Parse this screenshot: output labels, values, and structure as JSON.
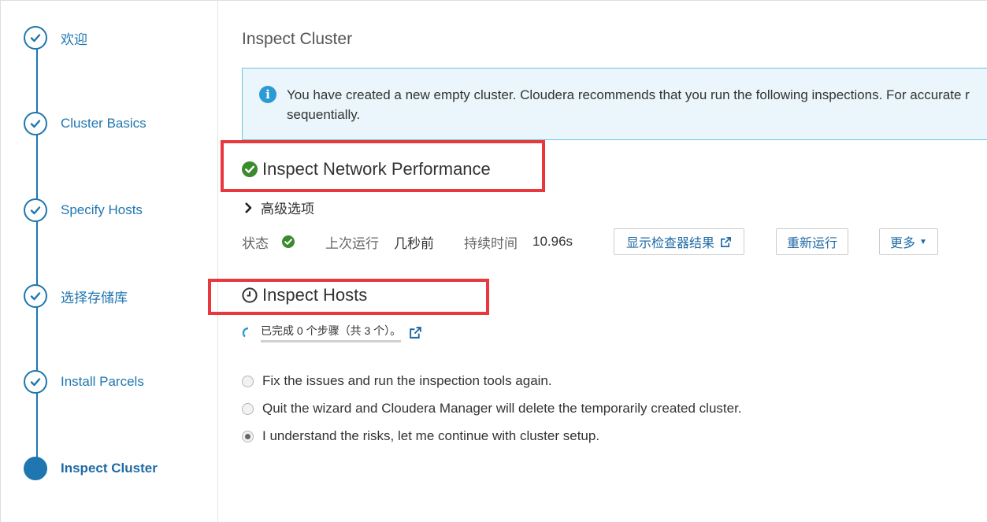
{
  "wizard": {
    "steps": [
      {
        "label": "欢迎",
        "state": "done"
      },
      {
        "label": "Cluster Basics",
        "state": "done"
      },
      {
        "label": "Specify Hosts",
        "state": "done"
      },
      {
        "label": "选择存储库",
        "state": "done"
      },
      {
        "label": "Install Parcels",
        "state": "done"
      },
      {
        "label": "Inspect Cluster",
        "state": "current"
      }
    ]
  },
  "main": {
    "title": "Inspect Cluster",
    "info": {
      "line1": "You have created a new empty cluster. Cloudera recommends that you run the following inspections. For accurate r",
      "line2": "sequentially."
    },
    "network": {
      "title": "Inspect Network Performance",
      "advanced_label": "高级选项",
      "status_label": "状态",
      "last_run_label": "上次运行",
      "last_run_value": "几秒前",
      "duration_label": "持续时间",
      "duration_value": "10.96s",
      "show_results_button": "显示检查器结果",
      "rerun_button": "重新运行",
      "more_button": "更多"
    },
    "hosts": {
      "title": "Inspect Hosts",
      "progress_text": "已完成 0 个步骤（共 3 个）。"
    },
    "options": [
      {
        "label": "Fix the issues and run the inspection tools again.",
        "checked": false
      },
      {
        "label": "Quit the wizard and Cloudera Manager will delete the temporarily created cluster.",
        "checked": false
      },
      {
        "label": "I understand the risks, let me continue with cluster setup.",
        "checked": true
      }
    ]
  },
  "colors": {
    "accent": "#1f76b0",
    "success": "#3c8a2e",
    "highlight": "#e8383d",
    "info_bg": "#eaf6fb"
  }
}
